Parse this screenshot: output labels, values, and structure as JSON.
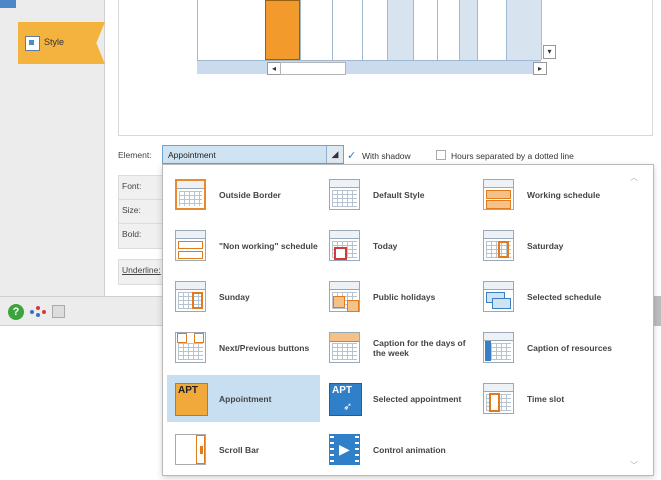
{
  "sidebar": {
    "style_tab_label": "Style"
  },
  "element_row": {
    "label": "Element:",
    "selected_value": "Appointment",
    "with_shadow_label": "With shadow",
    "with_shadow_checked": true,
    "dotted_label": "Hours separated by a dotted line",
    "dotted_checked": false
  },
  "fields": [
    "Font:",
    "Size:",
    "Bold:",
    "Underline:"
  ],
  "colors": {
    "accent_orange": "#f39a2c",
    "selected_bg": "#c7dff0",
    "help_green": "#3ca43c"
  },
  "popup": {
    "items": [
      {
        "label": "Outside Border",
        "icon": "outside-border-icon"
      },
      {
        "label": "Default Style",
        "icon": "default-style-icon"
      },
      {
        "label": "Working schedule",
        "icon": "working-schedule-icon"
      },
      {
        "label": "\"Non working\" schedule",
        "icon": "non-working-schedule-icon"
      },
      {
        "label": "Today",
        "icon": "today-icon"
      },
      {
        "label": "Saturday",
        "icon": "saturday-icon"
      },
      {
        "label": "Sunday",
        "icon": "sunday-icon"
      },
      {
        "label": "Public holidays",
        "icon": "public-holidays-icon"
      },
      {
        "label": "Selected schedule",
        "icon": "selected-schedule-icon"
      },
      {
        "label": "Next/Previous buttons",
        "icon": "next-previous-buttons-icon"
      },
      {
        "label": "Caption for the days of the week",
        "icon": "caption-days-icon"
      },
      {
        "label": "Caption of resources",
        "icon": "caption-resources-icon"
      },
      {
        "label": "Appointment",
        "icon": "appointment-icon",
        "icon_text": "APT"
      },
      {
        "label": "Selected appointment",
        "icon": "selected-appointment-icon",
        "icon_text": "APT"
      },
      {
        "label": "Time slot",
        "icon": "time-slot-icon"
      },
      {
        "label": "Scroll Bar",
        "icon": "scroll-bar-icon"
      },
      {
        "label": "Control animation",
        "icon": "control-animation-icon"
      }
    ]
  }
}
